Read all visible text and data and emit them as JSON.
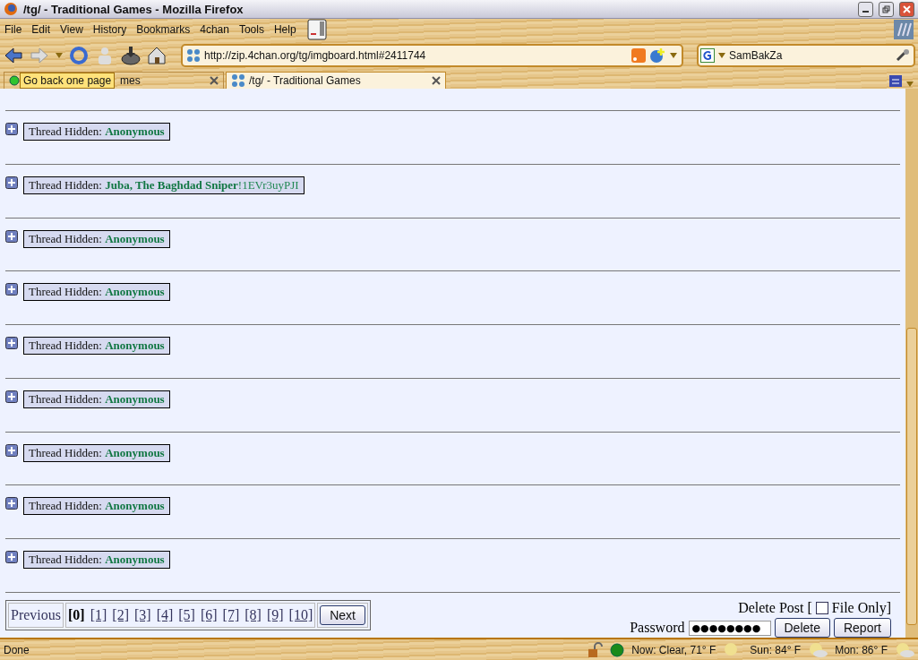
{
  "window": {
    "title": "/tg/ - Traditional Games - Mozilla Firefox"
  },
  "menu": [
    "File",
    "Edit",
    "View",
    "History",
    "Bookmarks",
    "4chan",
    "Tools",
    "Help"
  ],
  "address": {
    "value": "http://zip.4chan.org/tg/imgboard.html#2411744"
  },
  "search": {
    "value": "SamBakZa"
  },
  "tabs": [
    {
      "label": "mes",
      "selected": false
    },
    {
      "label": "/tg/ - Traditional Games",
      "selected": true
    }
  ],
  "tooltip": "Go back one page",
  "threads": [
    {
      "label": "Thread Hidden:",
      "name": "Anonymous"
    },
    {
      "label": "Thread Hidden:",
      "name": "Juba, The Baghdad Sniper",
      "trip": "!1EVr3uyPJI"
    },
    {
      "label": "Thread Hidden:",
      "name": "Anonymous"
    },
    {
      "label": "Thread Hidden:",
      "name": "Anonymous"
    },
    {
      "label": "Thread Hidden:",
      "name": "Anonymous"
    },
    {
      "label": "Thread Hidden:",
      "name": "Anonymous"
    },
    {
      "label": "Thread Hidden:",
      "name": "Anonymous"
    },
    {
      "label": "Thread Hidden:",
      "name": "Anonymous"
    },
    {
      "label": "Thread Hidden:",
      "name": "Anonymous"
    }
  ],
  "pagination": {
    "previous": "Previous",
    "next": "Next",
    "pages": [
      {
        "label": "[0]",
        "selected": true
      },
      {
        "label": "[1]",
        "selected": false
      },
      {
        "label": "[2]",
        "selected": false
      },
      {
        "label": "[3]",
        "selected": false
      },
      {
        "label": "[4]",
        "selected": false
      },
      {
        "label": "[5]",
        "selected": false
      },
      {
        "label": "[6]",
        "selected": false
      },
      {
        "label": "[7]",
        "selected": false
      },
      {
        "label": "[8]",
        "selected": false
      },
      {
        "label": "[9]",
        "selected": false
      },
      {
        "label": "[10]",
        "selected": false
      }
    ]
  },
  "delete_form": {
    "label": "Delete Post [",
    "file_only": {
      "label": "File Only]",
      "checked": false
    },
    "password_label": "Password",
    "password_value": "●●●●●●●●",
    "buttons": [
      "Delete",
      "Report"
    ]
  },
  "status_bar": {
    "text": "Done",
    "weather": [
      "Now: Clear, 71° F",
      "Sun: 84° F",
      "Mon: 86° F"
    ]
  }
}
